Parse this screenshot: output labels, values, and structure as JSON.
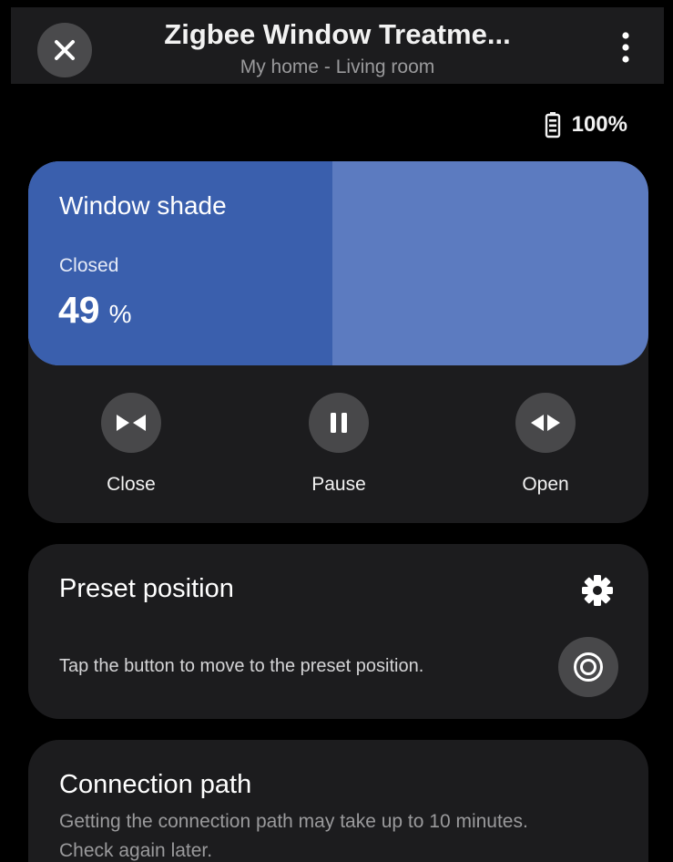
{
  "header": {
    "title": "Zigbee Window Treatme...",
    "subtitle": "My home - Living room",
    "close_icon": "close-icon",
    "more_icon": "more-vertical-icon"
  },
  "battery": {
    "icon": "battery-icon",
    "value": "100%"
  },
  "shade": {
    "name": "Window shade",
    "status": "Closed",
    "level": "49",
    "unit": "%",
    "level_fraction": 0.49,
    "colors": {
      "fill": "#3a5fad",
      "track": "#5c7bc0"
    },
    "controls": [
      {
        "label": "Close",
        "icon": "close-shade-icon"
      },
      {
        "label": "Pause",
        "icon": "pause-icon"
      },
      {
        "label": "Open",
        "icon": "open-shade-icon"
      }
    ]
  },
  "preset": {
    "title": "Preset position",
    "description": "Tap the button to move to the preset position.",
    "settings_icon": "gear-icon",
    "button_icon": "target-icon"
  },
  "connection": {
    "title": "Connection path",
    "description": "Getting the connection path may take up to 10 minutes. Check again later."
  }
}
